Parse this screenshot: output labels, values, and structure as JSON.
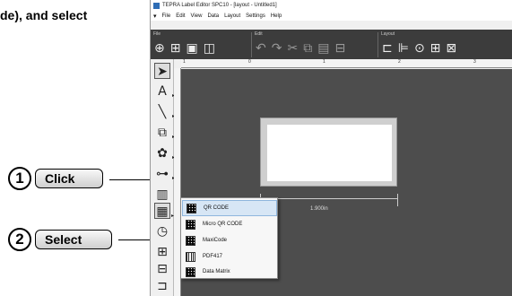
{
  "instruction_top": "de), and select",
  "callouts": [
    {
      "number": "1",
      "label": "Click"
    },
    {
      "number": "2",
      "label": "Select"
    }
  ],
  "window": {
    "title": "TEPRA Label Editor SPC10 - [layout - Untitled1]"
  },
  "menu": [
    "File",
    "Edit",
    "View",
    "Data",
    "Layout",
    "Settings",
    "Help"
  ],
  "ribbon_groups": [
    "File",
    "Edit",
    "Layout"
  ],
  "ruler_marks": [
    "1",
    "0",
    "1",
    "2",
    "3"
  ],
  "dimension_label": "1.900in",
  "barcode_menu": [
    {
      "label": "QR CODE",
      "icon": "qr-code-icon",
      "highlighted": true
    },
    {
      "label": "Micro QR CODE",
      "icon": "micro-qr-code-icon",
      "highlighted": false
    },
    {
      "label": "MaxiCode",
      "icon": "maxicode-icon",
      "highlighted": false
    },
    {
      "label": "PDF417",
      "icon": "pdf417-icon",
      "highlighted": false
    },
    {
      "label": "Data Matrix",
      "icon": "data-matrix-icon",
      "highlighted": false
    }
  ],
  "colors": {
    "ribbon": "#3c3c3c",
    "canvas": "#4d4d4d",
    "menu_highlight": "#d7e6f5"
  }
}
